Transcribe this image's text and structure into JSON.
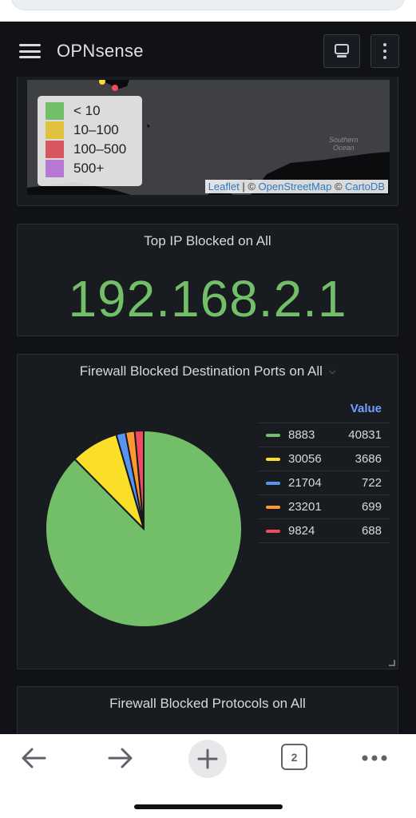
{
  "app": {
    "title": "OPNsense",
    "monitor_icon": "monitor-icon",
    "kebab_icon": "more-vertical-icon"
  },
  "map_panel": {
    "legend": [
      {
        "label": "< 10",
        "color": "#73bf69"
      },
      {
        "label": "10–100",
        "color": "#fade2a"
      },
      {
        "label": "100–500",
        "color": "#f2495c"
      },
      {
        "label": "500+",
        "color": "#b877d9"
      }
    ],
    "ocean_label_1": "Southern",
    "ocean_label_2": "Ocean",
    "attribution": {
      "leaflet": "Leaflet",
      "sep1": " | © ",
      "osm": "OpenStreetMap",
      "sep2": " © ",
      "carto": "CartoDB"
    }
  },
  "top_ip_panel": {
    "title": "Top IP Blocked on All",
    "value": "192.168.2.1",
    "value_color": "#73bf69"
  },
  "ports_panel": {
    "title": "Firewall Blocked Destination Ports on All",
    "legend_header": "Value",
    "chart_data": {
      "type": "pie",
      "title": "Firewall Blocked Destination Ports on All",
      "categories": [
        "8883",
        "30056",
        "21704",
        "23201",
        "9824"
      ],
      "values": [
        40831,
        3686,
        722,
        699,
        688
      ],
      "colors": [
        "#73bf69",
        "#fade2a",
        "#5794f2",
        "#ff9830",
        "#f2495c"
      ],
      "legend_position": "right"
    }
  },
  "protocols_panel": {
    "title": "Firewall Blocked Protocols on All"
  },
  "browser": {
    "tab_count": "2",
    "back_icon": "arrow-left-icon",
    "forward_icon": "arrow-right-icon",
    "new_tab_icon": "plus-icon",
    "more_icon": "more-horizontal-icon"
  }
}
